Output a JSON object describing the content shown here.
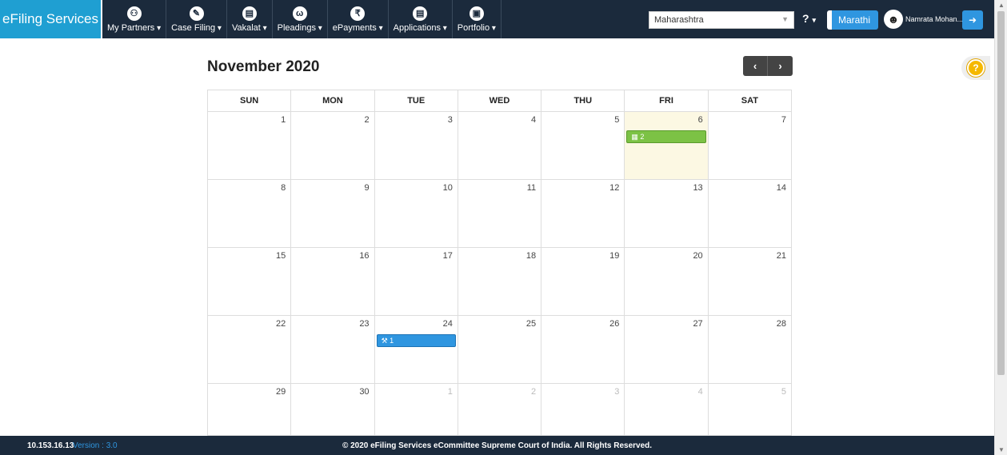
{
  "header": {
    "brand": "eFiling Services",
    "nav": [
      {
        "label": "My Partners",
        "icon": "users-icon",
        "glyph": "⚇"
      },
      {
        "label": "Case Filing",
        "icon": "pencil-icon",
        "glyph": "✎"
      },
      {
        "label": "Vakalat",
        "icon": "document-icon",
        "glyph": "▤"
      },
      {
        "label": "Pleadings",
        "icon": "hands-icon",
        "glyph": "ω"
      },
      {
        "label": "ePayments",
        "icon": "rupee-icon",
        "glyph": "₹"
      },
      {
        "label": "Applications",
        "icon": "file-icon",
        "glyph": "▤"
      },
      {
        "label": "Portfolio",
        "icon": "briefcase-icon",
        "glyph": "▣"
      }
    ],
    "state_select": "Maharashtra",
    "help_label": "?",
    "language_button": "Marathi",
    "user_name": "Namrata Mohan..."
  },
  "calendar": {
    "title": "November 2020",
    "weekdays": [
      "SUN",
      "MON",
      "TUE",
      "WED",
      "THU",
      "FRI",
      "SAT"
    ],
    "weeks": [
      [
        {
          "d": "1"
        },
        {
          "d": "2"
        },
        {
          "d": "3"
        },
        {
          "d": "4"
        },
        {
          "d": "5"
        },
        {
          "d": "6",
          "today": true,
          "event": {
            "label": "2",
            "color": "green",
            "icon": "calendar-icon"
          }
        },
        {
          "d": "7"
        }
      ],
      [
        {
          "d": "8"
        },
        {
          "d": "9"
        },
        {
          "d": "10"
        },
        {
          "d": "11"
        },
        {
          "d": "12"
        },
        {
          "d": "13"
        },
        {
          "d": "14"
        }
      ],
      [
        {
          "d": "15"
        },
        {
          "d": "16"
        },
        {
          "d": "17"
        },
        {
          "d": "18"
        },
        {
          "d": "19"
        },
        {
          "d": "20"
        },
        {
          "d": "21"
        }
      ],
      [
        {
          "d": "22"
        },
        {
          "d": "23"
        },
        {
          "d": "24",
          "event": {
            "label": "1",
            "color": "blue",
            "icon": "gavel-icon"
          }
        },
        {
          "d": "25"
        },
        {
          "d": "26"
        },
        {
          "d": "27"
        },
        {
          "d": "28"
        }
      ],
      [
        {
          "d": "29"
        },
        {
          "d": "30"
        },
        {
          "d": "1",
          "other": true
        },
        {
          "d": "2",
          "other": true
        },
        {
          "d": "3",
          "other": true
        },
        {
          "d": "4",
          "other": true
        },
        {
          "d": "5",
          "other": true
        }
      ]
    ]
  },
  "footer": {
    "ip": "10.153.16.13",
    "version": "Version : 3.0",
    "copyright": "© 2020 eFiling Services eCommittee Supreme Court of India. All Rights Reserved."
  },
  "colors": {
    "brand": "#1f9fd2",
    "navbar": "#1b2a3c",
    "accent": "#2f96e0",
    "event_green": "#7cc245",
    "today": "#fcf8e3"
  }
}
